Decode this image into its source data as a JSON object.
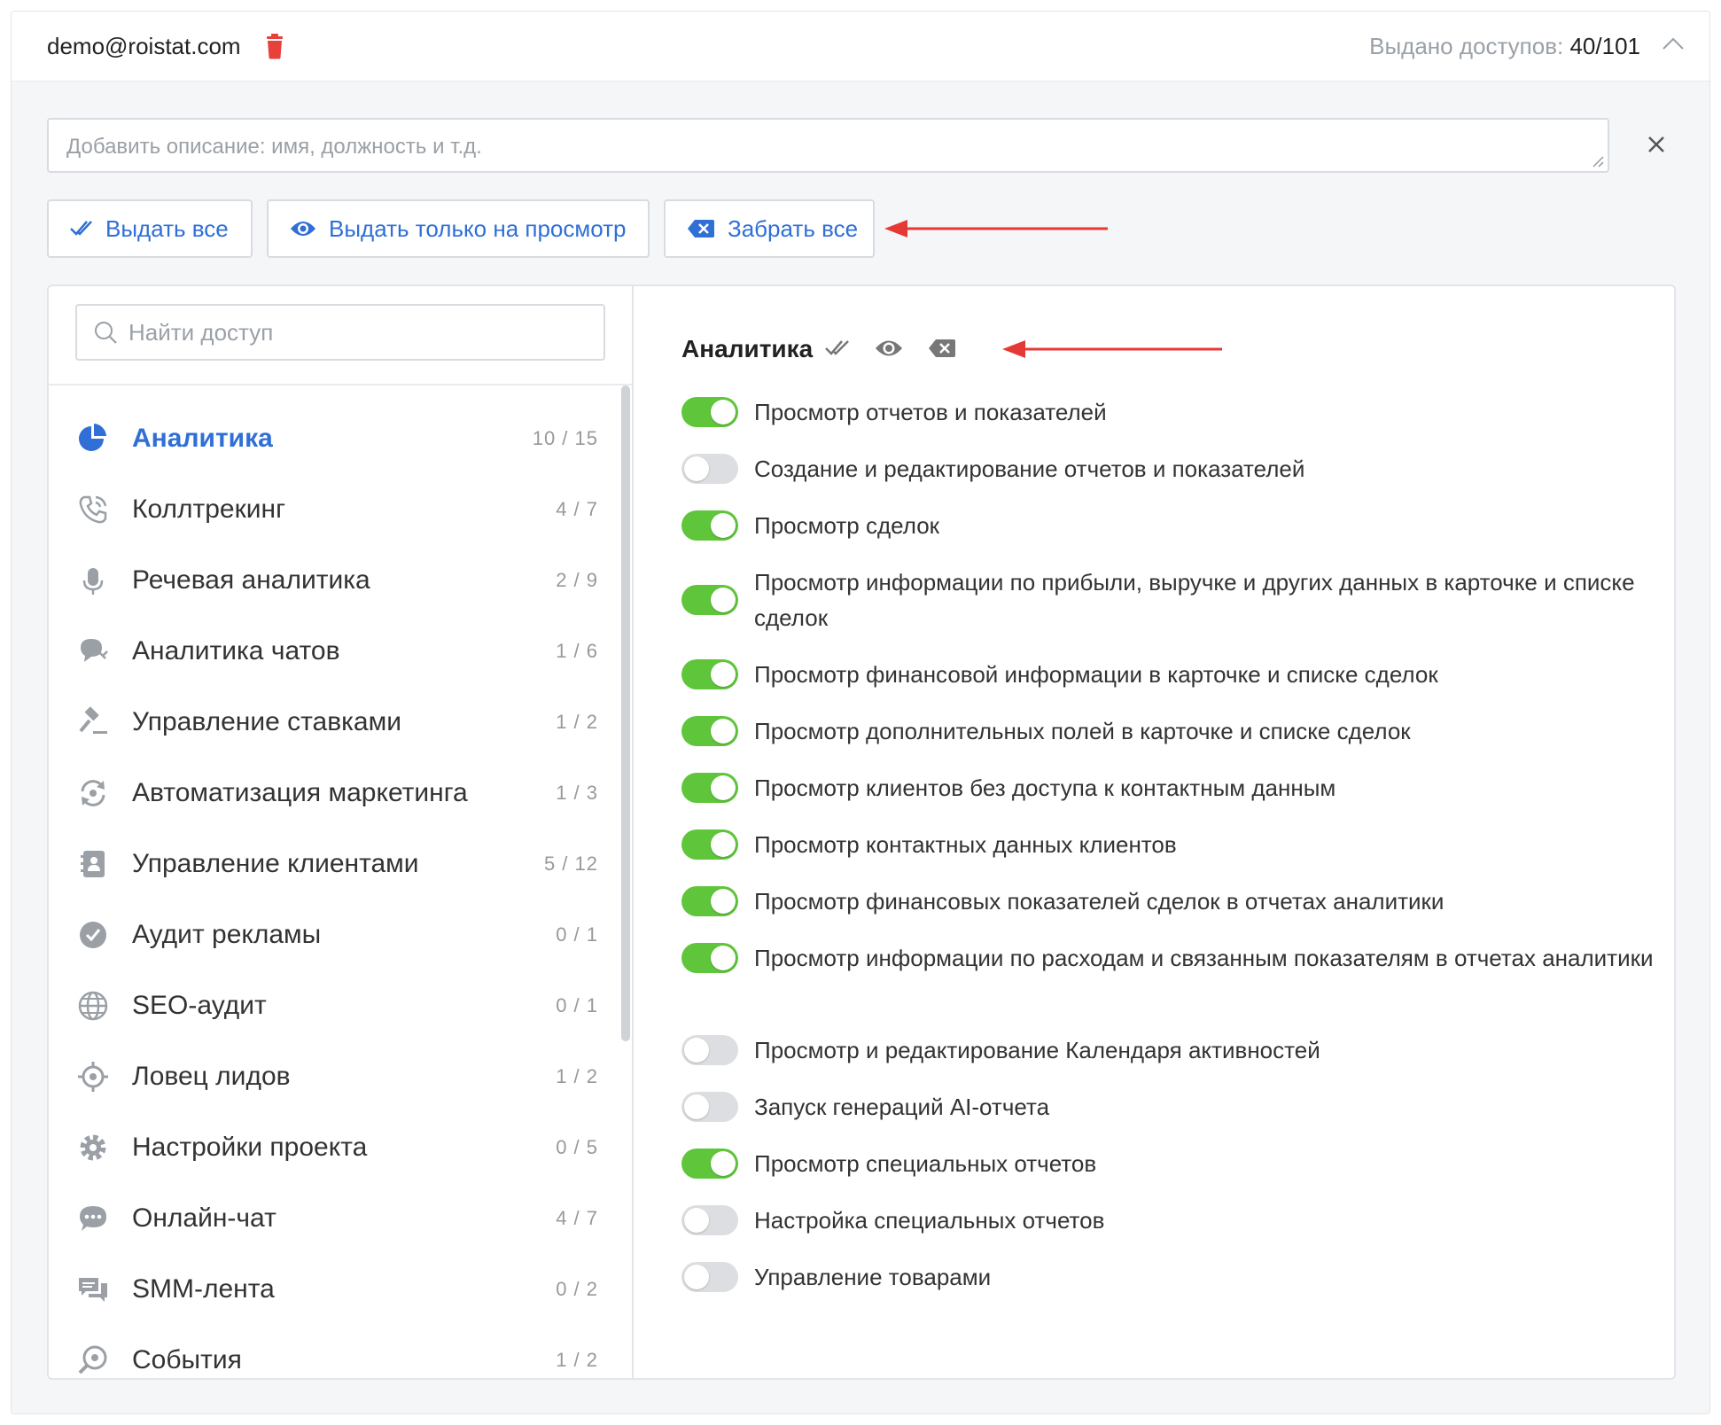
{
  "header": {
    "email": "demo@roistat.com",
    "issued_label": "Выдано доступов:",
    "issued_value": "40/101"
  },
  "description": {
    "placeholder": "Добавить описание: имя, должность и т.д."
  },
  "actions": {
    "grant_all": "Выдать все",
    "grant_view": "Выдать только на просмотр",
    "revoke_all": "Забрать все"
  },
  "search": {
    "placeholder": "Найти доступ"
  },
  "categories": [
    {
      "name": "Аналитика",
      "count": "10 / 15",
      "icon": "pie-chart-icon"
    },
    {
      "name": "Коллтрекинг",
      "count": "4 / 7",
      "icon": "phone-icon"
    },
    {
      "name": "Речевая аналитика",
      "count": "2 / 9",
      "icon": "microphone-icon"
    },
    {
      "name": "Аналитика чатов",
      "count": "1 / 6",
      "icon": "chat-analytics-icon"
    },
    {
      "name": "Управление ставками",
      "count": "1 / 2",
      "icon": "gavel-icon"
    },
    {
      "name": "Автоматизация маркетинга",
      "count": "1 / 3",
      "icon": "automation-icon"
    },
    {
      "name": "Управление клиентами",
      "count": "5 / 12",
      "icon": "contacts-icon"
    },
    {
      "name": "Аудит рекламы",
      "count": "0 / 1",
      "icon": "check-circle-icon"
    },
    {
      "name": "SEO-аудит",
      "count": "0 / 1",
      "icon": "globe-icon"
    },
    {
      "name": "Ловец лидов",
      "count": "1 / 2",
      "icon": "target-icon"
    },
    {
      "name": "Настройки проекта",
      "count": "0 / 5",
      "icon": "gear-icon"
    },
    {
      "name": "Онлайн-чат",
      "count": "4 / 7",
      "icon": "chat-bubble-icon"
    },
    {
      "name": "SMM-лента",
      "count": "0 / 2",
      "icon": "messages-icon"
    },
    {
      "name": "События",
      "count": "1 / 2",
      "icon": "events-icon"
    }
  ],
  "section": {
    "title": "Аналитика"
  },
  "permissions": [
    {
      "label": "Просмотр отчетов и показателей",
      "on": true
    },
    {
      "label": "Создание и редактирование отчетов и показателей",
      "on": false
    },
    {
      "label": "Просмотр сделок",
      "on": true
    },
    {
      "label": "Просмотр информации по прибыли, выручке и других данных в карточке и списке сделок",
      "on": true
    },
    {
      "label": "Просмотр финансовой информации в карточке и списке сделок",
      "on": true
    },
    {
      "label": "Просмотр дополнительных полей в карточке и списке сделок",
      "on": true
    },
    {
      "label": "Просмотр клиентов без доступа к контактным данным",
      "on": true
    },
    {
      "label": "Просмотр контактных данных клиентов",
      "on": true
    },
    {
      "label": "Просмотр финансовых показателей сделок в отчетах аналитики",
      "on": true
    },
    {
      "label": "Просмотр информации по расходам и связанным показателям в отчетах аналитики",
      "on": true
    },
    {
      "label": "Просмотр и редактирование Календаря активностей",
      "on": false
    },
    {
      "label": "Запуск генераций AI-отчета",
      "on": false
    },
    {
      "label": "Просмотр специальных отчетов",
      "on": true
    },
    {
      "label": "Настройка специальных отчетов",
      "on": false
    },
    {
      "label": "Управление товарами",
      "on": false
    }
  ],
  "colors": {
    "accent": "#2f6fd6",
    "toggle_on": "#5fc63b",
    "toggle_off": "#dcdee2",
    "danger": "#e8403a",
    "arrow": "#e53935"
  }
}
